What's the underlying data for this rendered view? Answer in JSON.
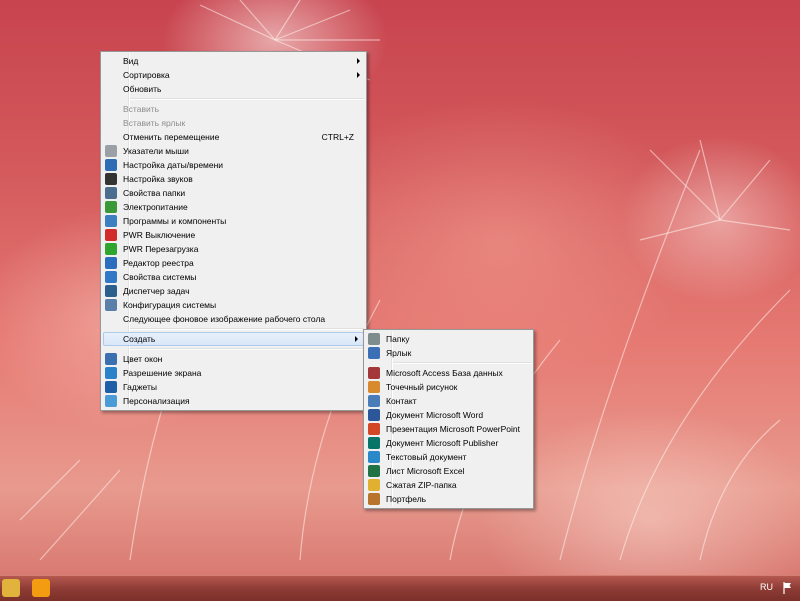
{
  "desktop_menu": {
    "items": [
      {
        "label": "Вид",
        "submenu": true
      },
      {
        "label": "Сортировка",
        "submenu": true
      },
      {
        "label": "Обновить"
      },
      {
        "separator": true
      },
      {
        "label": "Вставить",
        "disabled": true
      },
      {
        "label": "Вставить ярлык",
        "disabled": true
      },
      {
        "label": "Отменить перемещение",
        "shortcut": "CTRL+Z"
      },
      {
        "label": "Указатели мыши",
        "icon": "mouse-pointer-icon",
        "color": "#9aa0a6"
      },
      {
        "label": "Настройка даты/времени",
        "icon": "clock-icon",
        "color": "#2e6db3"
      },
      {
        "label": "Настройка звуков",
        "icon": "speaker-icon",
        "color": "#333333"
      },
      {
        "label": "Свойства папки",
        "icon": "folder-options-icon",
        "color": "#4b6e8f"
      },
      {
        "label": "Электропитание",
        "icon": "battery-icon",
        "color": "#3a9a3a"
      },
      {
        "label": "Программы и компоненты",
        "icon": "programs-icon",
        "color": "#3d7fc1"
      },
      {
        "label": "PWR Выключение",
        "icon": "power-off-icon",
        "color": "#d12b2b"
      },
      {
        "label": "PWR Перезагрузка",
        "icon": "restart-icon",
        "color": "#2fa52f"
      },
      {
        "label": "Редактор реестра",
        "icon": "registry-icon",
        "color": "#2a6ebd"
      },
      {
        "label": "Свойства системы",
        "icon": "system-properties-icon",
        "color": "#3178c6"
      },
      {
        "label": "Диспетчер задач",
        "icon": "task-manager-icon",
        "color": "#2b5f8d"
      },
      {
        "label": "Конфигурация системы",
        "icon": "msconfig-icon",
        "color": "#5a7fa8"
      },
      {
        "label": "Следующее фоновое изображение рабочего стола"
      },
      {
        "separator": true
      },
      {
        "label": "Создать",
        "submenu": true,
        "highlighted": true
      },
      {
        "separator": true
      },
      {
        "label": "Цвет окон",
        "icon": "window-color-icon",
        "color": "#3a6fb0"
      },
      {
        "label": "Разрешение экрана",
        "icon": "display-icon",
        "color": "#2c82c9"
      },
      {
        "label": "Гаджеты",
        "icon": "gadgets-icon",
        "color": "#1f5fa8"
      },
      {
        "label": "Персонализация",
        "icon": "personalization-icon",
        "color": "#4a9bd6"
      }
    ]
  },
  "create_submenu": {
    "items": [
      {
        "label": "Папку",
        "icon": "folder-icon",
        "color": "#7f8c8d"
      },
      {
        "label": "Ярлык",
        "icon": "shortcut-icon",
        "color": "#3b6fb6"
      },
      {
        "separator": true
      },
      {
        "label": "Microsoft Access База данных",
        "icon": "access-icon",
        "color": "#a4373a"
      },
      {
        "label": "Точечный рисунок",
        "icon": "bitmap-icon",
        "color": "#d88a2e"
      },
      {
        "label": "Контакт",
        "icon": "contact-icon",
        "color": "#4a7db8"
      },
      {
        "label": "Документ Microsoft Word",
        "icon": "word-icon",
        "color": "#2b579a"
      },
      {
        "label": "Презентация Microsoft PowerPoint",
        "icon": "powerpoint-icon",
        "color": "#d24726"
      },
      {
        "label": "Документ Microsoft Publisher",
        "icon": "publisher-icon",
        "color": "#077568"
      },
      {
        "label": "Текстовый документ",
        "icon": "text-document-icon",
        "color": "#2a88c8"
      },
      {
        "label": "Лист Microsoft Excel",
        "icon": "excel-icon",
        "color": "#217346"
      },
      {
        "label": "Сжатая ZIP-папка",
        "icon": "zip-folder-icon",
        "color": "#e0b030"
      },
      {
        "label": "Портфель",
        "icon": "briefcase-icon",
        "color": "#b8742c"
      }
    ]
  },
  "taskbar": {
    "language": "RU",
    "pinned": [
      {
        "icon": "explorer-icon",
        "color": "#e2b33c"
      },
      {
        "icon": "media-player-icon",
        "color": "#f39c12"
      }
    ]
  }
}
